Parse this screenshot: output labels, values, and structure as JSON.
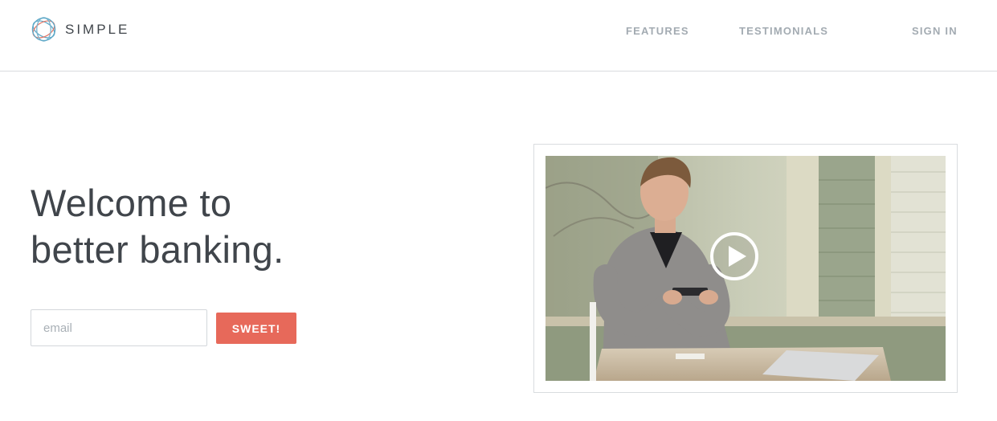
{
  "brand": {
    "name": "SIMPLE",
    "logo_icon": "simple-logo-rings",
    "accent_color": "#e7695a"
  },
  "nav": {
    "features": "FEATURES",
    "testimonials": "TESTIMONIALS",
    "sign_in": "SIGN IN"
  },
  "hero": {
    "line1": "Welcome to",
    "line2": "better banking."
  },
  "signup": {
    "email_placeholder": "email",
    "email_value": "",
    "submit_label": "SWEET!"
  },
  "video": {
    "play_icon": "play-circle-icon"
  }
}
